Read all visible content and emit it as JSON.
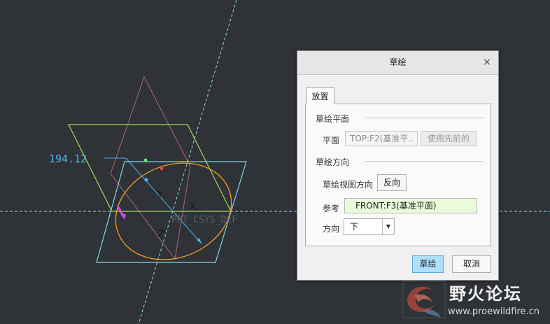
{
  "viewport": {
    "dimension_label": "194.12",
    "csys_label": "PRT_CSYS_DEF",
    "axis_x": "X",
    "axis_y": "Y",
    "axis_z": "Z",
    "colors": {
      "background": "#2f3237",
      "datum_plane_green": "#9fe055",
      "datum_plane_cyan": "#7fd8e8",
      "sketch_circle": "#f0a020",
      "dimension": "#4fb7ea",
      "dashed_axis": "#8edfe8"
    }
  },
  "dialog": {
    "title": "草绘",
    "close_glyph": "×",
    "tabs": [
      {
        "label": "放置"
      }
    ],
    "sketch_plane": {
      "group_title": "草绘平面",
      "plane_label": "平面",
      "plane_value": "TOP:F2(基准平..",
      "use_previous_label": "使用先前的"
    },
    "sketch_orientation": {
      "group_title": "草绘方向",
      "view_direction_label": "草绘视图方向",
      "flip_label": "反向",
      "reference_label": "参考",
      "reference_value": "FRONT:F3(基准平面)",
      "orientation_label": "方向",
      "orientation_value": "下"
    },
    "sketch_button": "草绘",
    "cancel_button": "取消"
  },
  "watermark": {
    "title": "野火论坛",
    "url": "www.proewildfire.cn"
  }
}
